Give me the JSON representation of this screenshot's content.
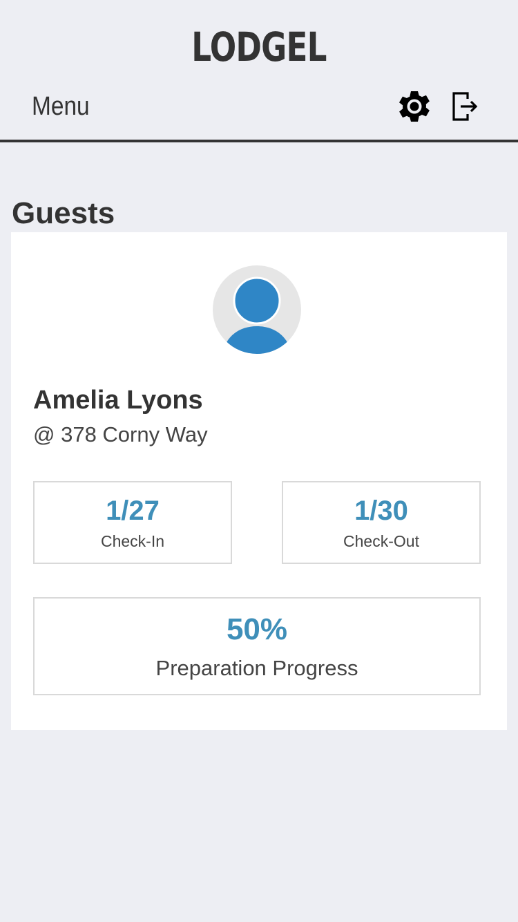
{
  "header": {
    "brand_title": "LODGEL",
    "menu_label": "Menu",
    "settings_icon": "gear-icon",
    "logout_icon": "logout-icon"
  },
  "main": {
    "section_title": "Guests",
    "guest": {
      "name": "Amelia Lyons",
      "address": "@ 378 Corny Way",
      "avatar_icon": "user-avatar-icon",
      "check_in": {
        "value": "1/27",
        "label": "Check-In"
      },
      "check_out": {
        "value": "1/30",
        "label": "Check-Out"
      },
      "progress": {
        "value": "50%",
        "label": "Preparation Progress",
        "percent": 50
      }
    }
  },
  "colors": {
    "background": "#edeef3",
    "card_background": "#ffffff",
    "accent": "#3f8fb9",
    "avatar_blue": "#2f86c6",
    "text_dark": "#333333",
    "border": "#d9d9d9"
  }
}
